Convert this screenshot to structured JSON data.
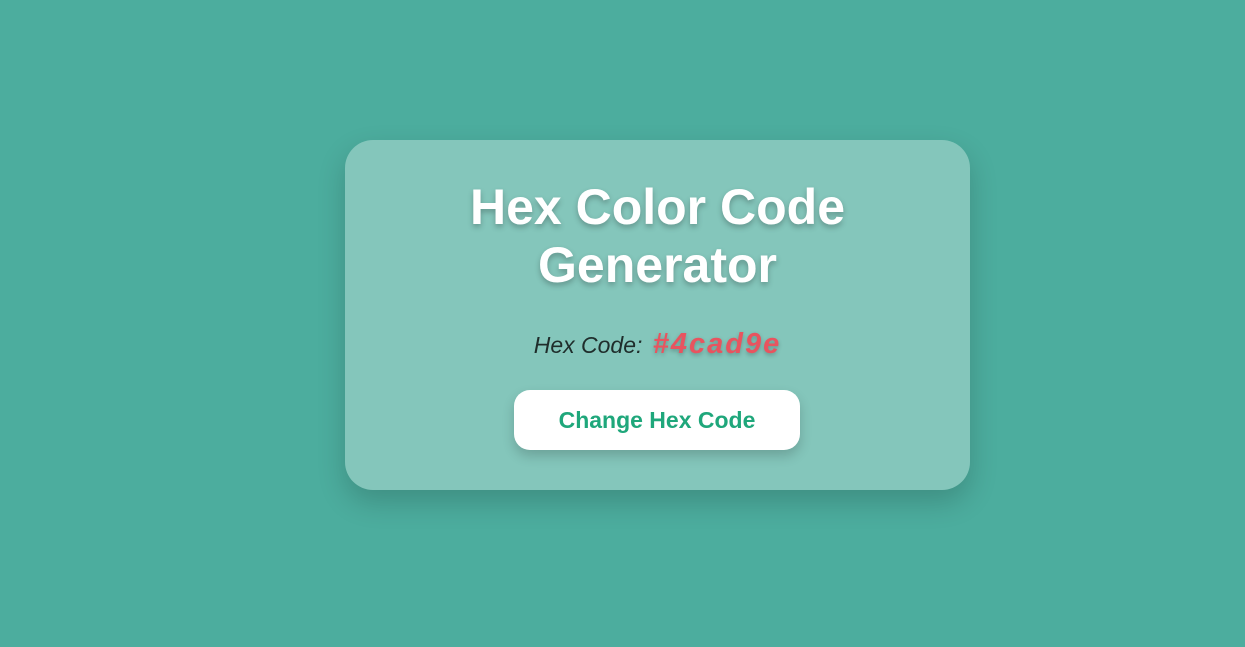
{
  "page": {
    "background_color": "#4cad9e"
  },
  "card": {
    "title": "Hex Color Code Generator",
    "hex_label": "Hex Code:",
    "hex_value": "#4cad9e",
    "button_label": "Change Hex Code"
  },
  "colors": {
    "card_background": "#84c6bb",
    "title_text": "#ffffff",
    "hex_value_text": "#e8545f",
    "button_text": "#1fa77b",
    "button_background": "#ffffff"
  }
}
